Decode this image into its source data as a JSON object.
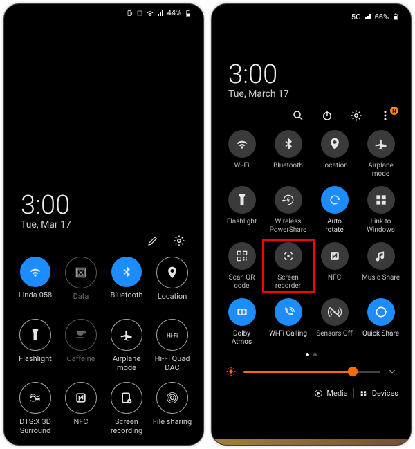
{
  "left": {
    "status": {
      "battery": "44%",
      "signal_icons": [
        "vibrate",
        "nfc",
        "wifi",
        "signal"
      ]
    },
    "time": "3:00",
    "date": "Tue, Mar 17",
    "edit_icons": [
      "pencil",
      "settings"
    ],
    "tiles": [
      {
        "label": "Linda-058",
        "icon": "wifi",
        "active": true
      },
      {
        "label": "Data",
        "icon": "data",
        "dimmed": true
      },
      {
        "label": "Bluetooth",
        "icon": "bluetooth",
        "active": true
      },
      {
        "label": "Location",
        "icon": "location"
      },
      {
        "label": "Flashlight",
        "icon": "flashlight"
      },
      {
        "label": "Caffeine",
        "icon": "cup",
        "dimmed": true
      },
      {
        "label": "Airplane\nmode",
        "icon": "airplane"
      },
      {
        "label": "Hi-Fi Quad\nDAC",
        "icon": "hifi"
      },
      {
        "label": "DTS:X 3D\nSurround",
        "icon": "dts"
      },
      {
        "label": "NFC",
        "icon": "nfc"
      },
      {
        "label": "Screen\nrecording",
        "icon": "screenrec"
      },
      {
        "label": "File sharing",
        "icon": "fileshare"
      }
    ]
  },
  "right": {
    "status": {
      "network": "5G",
      "signal": true,
      "battery": "66%"
    },
    "time": "3:00",
    "date": "Tue, March 17",
    "actions": [
      "search",
      "power",
      "settings",
      "more"
    ],
    "notif_badge": "N",
    "tiles": [
      {
        "label": "Wi-Fi",
        "icon": "wifi"
      },
      {
        "label": "Bluetooth",
        "icon": "bluetooth"
      },
      {
        "label": "Location",
        "icon": "location"
      },
      {
        "label": "Airplane\nmode",
        "icon": "airplane"
      },
      {
        "label": "Flashlight",
        "icon": "flashlight"
      },
      {
        "label": "Wireless\nPowerShare",
        "icon": "powershare"
      },
      {
        "label": "Auto\nrotate",
        "icon": "rotate",
        "active": true
      },
      {
        "label": "Link to\nWindows",
        "icon": "windows"
      },
      {
        "label": "Scan QR\ncode",
        "icon": "qr"
      },
      {
        "label": "Screen\nrecorder",
        "icon": "screenrec",
        "highlighted": true
      },
      {
        "label": "NFC",
        "icon": "nfc2"
      },
      {
        "label": "Music Share",
        "icon": "music"
      },
      {
        "label": "Dolby\nAtmos",
        "icon": "dolby",
        "active": true
      },
      {
        "label": "Wi-Fi Calling",
        "icon": "wificall",
        "active": true
      },
      {
        "label": "Sensors Off",
        "icon": "sensors"
      },
      {
        "label": "Quick Share",
        "icon": "quickshare",
        "active": true
      }
    ],
    "page_index": 0,
    "page_count": 2,
    "brightness_pct": 80,
    "bottom": {
      "media": "Media",
      "devices": "Devices"
    }
  }
}
